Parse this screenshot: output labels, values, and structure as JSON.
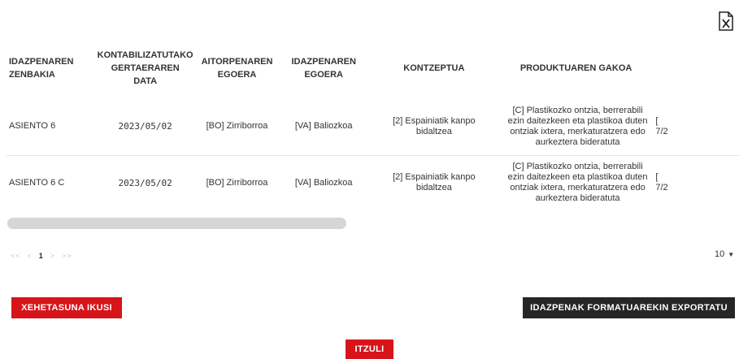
{
  "table": {
    "columns": [
      "IDAZPENAREN\nZENBAKIA",
      "KONTABILIZATUTAKO\nGERTAERAREN\nDATA",
      "AITORPENAREN\nEGOERA",
      "IDAZPENAREN\nEGOERA",
      "KONTZEPTUA",
      "PRODUKTUAREN GAKOA"
    ],
    "rows": [
      {
        "entry_number": "ASIENTO 6",
        "date": "2023/05/02",
        "declaration_status": "[BO] Zirriborroa",
        "entry_status": "[VA] Baliozkoa",
        "concept": "[2] Espainiatik kanpo bidaltzea",
        "product_key": "[C] Plastikozko ontzia, berrerabili ezin daitezkeen eta plastikoa duten ontziak ixtera, merkaturatzera edo aurkeztera bideratuta",
        "extra": "[\n7/2"
      },
      {
        "entry_number": "ASIENTO 6 C",
        "date": "2023/05/02",
        "declaration_status": "[BO] Zirriborroa",
        "entry_status": "[VA] Baliozkoa",
        "concept": "[2] Espainiatik kanpo bidaltzea",
        "product_key": "[C] Plastikozko ontzia, berrerabili ezin daitezkeen eta plastikoa duten ontziak ixtera, merkaturatzera edo aurkeztera bideratuta",
        "extra": "[\n7/2"
      }
    ]
  },
  "pagination": {
    "first": "<<",
    "prev": "<",
    "current": "1",
    "next": ">",
    "last": ">>",
    "page_size": "10"
  },
  "buttons": {
    "detail": "XEHETASUNA IKUSI",
    "export": "IDAZPENAK FORMATUAREKIN EXPORTATU",
    "back": "ITZULI"
  },
  "icons": {
    "export_excel": "excel-file-icon"
  },
  "colors": {
    "primary_red": "#d7141a",
    "dark_button": "#262626"
  }
}
